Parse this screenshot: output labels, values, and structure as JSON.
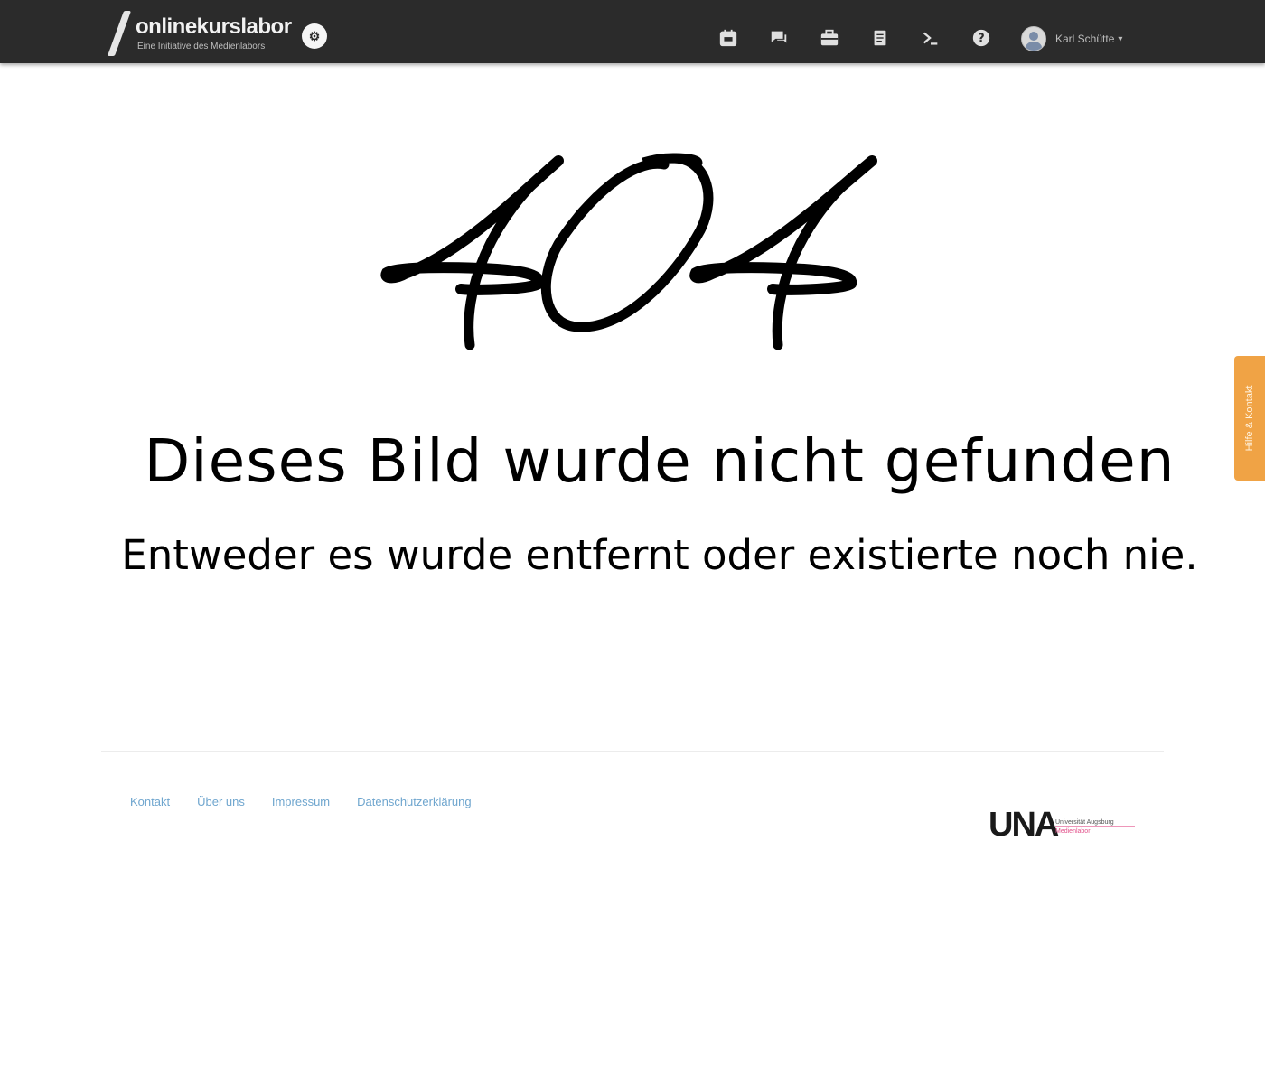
{
  "navbar": {
    "brand_name": "onlinekurslabor",
    "brand_tagline": "Eine Initiative des Medienlabors",
    "brand_badge": "⚙",
    "icons": [
      {
        "name": "calendar-icon"
      },
      {
        "name": "chat-icon"
      },
      {
        "name": "briefcase-icon"
      },
      {
        "name": "notebook-icon"
      },
      {
        "name": "terminal-icon"
      },
      {
        "name": "help-icon"
      }
    ],
    "user_name": "Karl Schütte",
    "user_caret": "▾"
  },
  "error": {
    "code": "404",
    "headline": "Dieses Bild wurde nicht gefunden",
    "subline": "Entweder es wurde entfernt oder existierte noch nie."
  },
  "side_tab": {
    "label": "Hilfe & Kontakt"
  },
  "footer": {
    "links": [
      "Kontakt",
      "Über uns",
      "Impressum",
      "Datenschutzerklärung"
    ],
    "logo_mark": "UNA",
    "logo_line1": "Universität Augsburg",
    "logo_line2": "Medienlabor"
  },
  "colors": {
    "navbar_bg": "#2b2b2b",
    "side_tab_bg": "#f0a345",
    "link": "#4a8fc2",
    "logo_accent": "#e2508a"
  }
}
